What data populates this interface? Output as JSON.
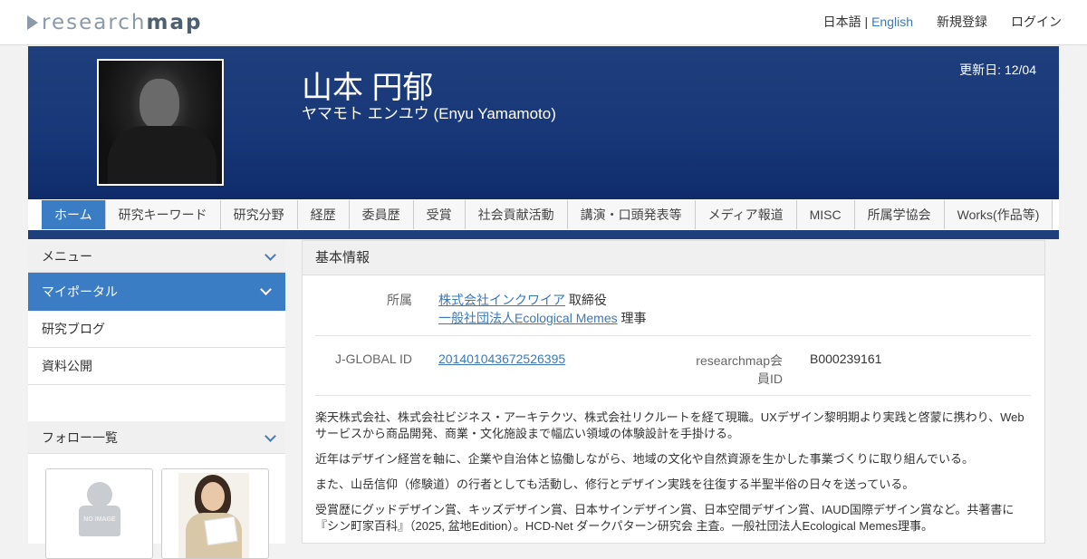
{
  "header": {
    "logo_light": "research",
    "logo_bold": "map",
    "lang_ja": "日本語",
    "lang_sep": "|",
    "lang_en": "English",
    "register": "新規登録",
    "login": "ログイン"
  },
  "profile": {
    "name": "山本 円郁",
    "kana": "ヤマモト エンユウ  (Enyu Yamamoto)",
    "updated": "更新日: 12/04"
  },
  "tabs": [
    {
      "label": "ホーム",
      "active": true
    },
    {
      "label": "研究キーワード"
    },
    {
      "label": "研究分野"
    },
    {
      "label": "経歴"
    },
    {
      "label": "委員歴"
    },
    {
      "label": "受賞"
    },
    {
      "label": "社会貢献活動"
    },
    {
      "label": "講演・口頭発表等"
    },
    {
      "label": "メディア報道"
    },
    {
      "label": "MISC"
    },
    {
      "label": "所属学協会"
    },
    {
      "label": "Works(作品等)"
    }
  ],
  "sidebar": {
    "menu_title": "メニュー",
    "active_item": "マイポータル",
    "items": [
      "研究ブログ",
      "資料公開"
    ],
    "follow_title": "フォロー一覧",
    "noimage_text": "NO IMAGE"
  },
  "main": {
    "section_title": "基本情報",
    "affiliation_label": "所属",
    "aff1_link": "株式会社インクワイア",
    "aff1_role": " 取締役",
    "aff2_link": "一般社団法人Ecological Memes",
    "aff2_role": " 理事",
    "jglobal_label": "J-GLOBAL ID",
    "jglobal_value": "201401043672526395",
    "rm_label_1": "researchmap会",
    "rm_label_2": "員ID",
    "rm_value": "B000239161",
    "paragraphs": [
      "楽天株式会社、株式会社ビジネス・アーキテクツ、株式会社リクルートを経て現職。UXデザイン黎明期より実践と啓蒙に携わり、Webサービスから商品開発、商業・文化施設まで幅広い領域の体験設計を手掛ける。",
      "近年はデザイン経営を軸に、企業や自治体と協働しながら、地域の文化や自然資源を生かした事業づくりに取り組んでいる。",
      "また、山岳信仰（修験道）の行者としても活動し、修行とデザイン実践を往復する半聖半俗の日々を送っている。",
      "受賞歴にグッドデザイン賞、キッズデザイン賞、日本サインデザイン賞、日本空間デザイン賞、IAUD国際デザイン賞など。共著書に『シン町家百科』（2025, 盆地Edition）。HCD-Net ダークパターン研究会 主査。一般社団法人Ecological Memes理事。"
    ]
  }
}
